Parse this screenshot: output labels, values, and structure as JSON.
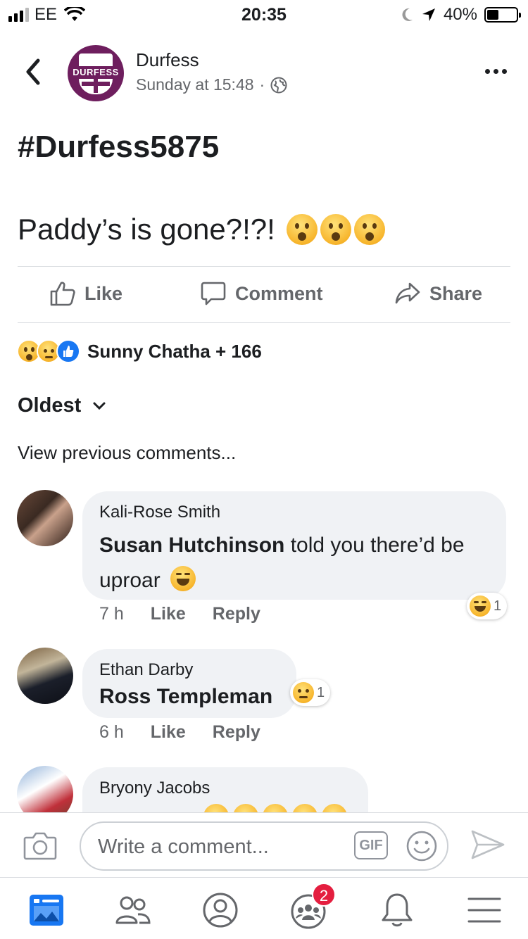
{
  "status_bar": {
    "carrier": "EE",
    "time": "20:35",
    "battery": "40%",
    "battery_level": 0.4
  },
  "header": {
    "page_name": "Durfess",
    "logo_text": "DURFESS",
    "timestamp": "Sunday at 15:48",
    "separator": "·"
  },
  "post": {
    "hashtag": "#Durfess5875",
    "text": "Paddy’s is gone?!?!"
  },
  "actions": {
    "like": "Like",
    "comment": "Comment",
    "share": "Share"
  },
  "reactions": {
    "summary": "Sunny Chatha + 166",
    "icons": [
      "wow-emoji",
      "sad-emoji",
      "like-icon"
    ]
  },
  "sort": {
    "label": "Oldest"
  },
  "view_previous": "View previous comments...",
  "comments": [
    {
      "author": "Kali-Rose Smith",
      "mention": "Susan Hutchinson",
      "text_line1_rest": " told you there’d be",
      "text_line2": "uproar",
      "time": "7 h",
      "like": "Like",
      "reply": "Reply",
      "reaction_count": "1",
      "reaction_icon": "laughing-emoji"
    },
    {
      "author": "Ethan Darby",
      "mention": "Ross Templeman",
      "time": "6 h",
      "like": "Like",
      "reply": "Reply",
      "reaction_count": "1",
      "reaction_icon": "sad-emoji"
    },
    {
      "author": "Bryony Jacobs"
    }
  ],
  "composer": {
    "placeholder": "Write a comment...",
    "gif": "GIF"
  },
  "tabbar": {
    "groups_badge": "2"
  },
  "colors": {
    "accent": "#1877f2",
    "page_brand": "#6e1e5e",
    "badge": "#e41e3f",
    "secondary_text": "#65676b",
    "bubble": "#f0f2f5"
  }
}
